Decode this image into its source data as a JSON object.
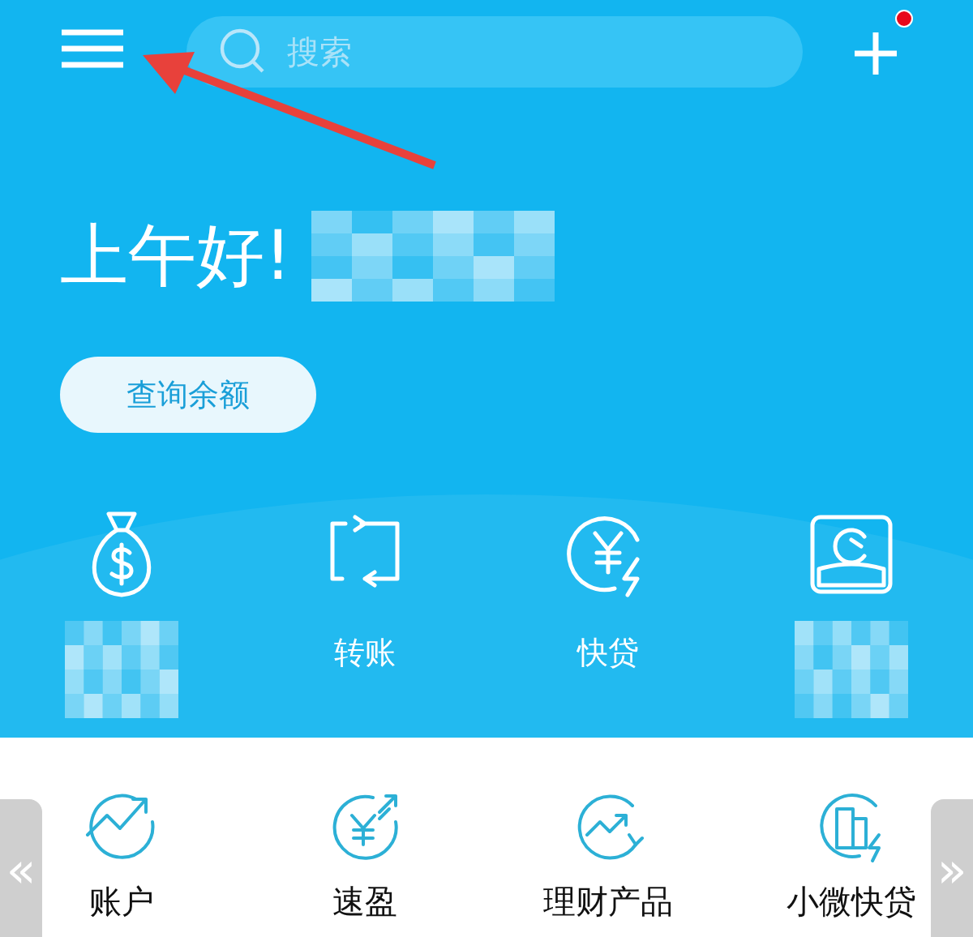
{
  "header": {
    "search": {
      "placeholder": "搜索"
    },
    "add_button": {
      "badge": true
    }
  },
  "greeting": "上午好!",
  "balance_button": "查询余额",
  "quick_actions": [
    {
      "kind": "money-bag"
    },
    {
      "kind": "transfer",
      "label": "转账"
    },
    {
      "kind": "loan",
      "label": "快贷"
    },
    {
      "kind": "pay"
    }
  ],
  "products": [
    {
      "kind": "growth",
      "label": "账户"
    },
    {
      "kind": "exchange",
      "label": "速盈"
    },
    {
      "kind": "trend",
      "label": "理财产品"
    },
    {
      "kind": "building",
      "label": "小微快贷"
    }
  ],
  "pager": {
    "prev": "«",
    "next": "»"
  }
}
